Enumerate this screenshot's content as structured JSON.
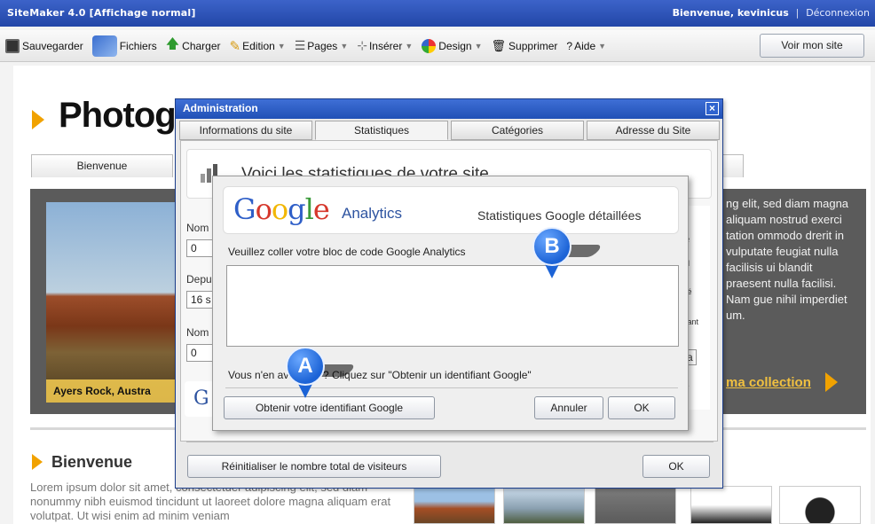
{
  "topbar": {
    "app_title": "SiteMaker 4.0",
    "mode": "[Affichage normal]",
    "welcome": "Bienvenue, kevinicus",
    "separator": "|",
    "logout": "Déconnexion"
  },
  "toolbar": {
    "save": "Sauvegarder",
    "files": "Fichiers",
    "upload": "Charger",
    "edit": "Edition",
    "pages": "Pages",
    "insert": "Insérer",
    "design": "Design",
    "delete": "Supprimer",
    "help": "Aide",
    "view_site": "Voir mon site"
  },
  "background_page": {
    "title": "Photogr",
    "tab": "Bienvenue",
    "photo_caption": "Ayers Rock, Austra",
    "band_text": "ng elit, sed diam magna aliquam nostrud exerci tation ommodo drerit in vulputate feugiat nulla facilisis ui blandit praesent nulla facilisi. Nam gue nihil imperdiet um.",
    "band_link": "ma collection",
    "section_title": "Bienvenue",
    "lorem": "Lorem ipsum dolor sit amet, consectetuer adipiscing elit, sed diam nonummy nibh euismod tincidunt ut laoreet dolore magna aliquam erat volutpat. Ut wisi enim ad minim veniam"
  },
  "admin": {
    "title": "Administration",
    "close": "×",
    "tabs": [
      "Informations du site",
      "Statistiques",
      "Catégories",
      "Adresse du Site"
    ],
    "active_tab": "Statistiques",
    "stats_title": "Voici les statistiques de votre site",
    "labels": [
      "Nom",
      "Depu",
      "Nom"
    ],
    "fields": [
      "0",
      "16 s",
      "0"
    ],
    "right_labels": [
      "e",
      "al",
      "sé",
      "itant",
      "a",
      "e"
    ],
    "reset_button": "Réinitialiser le nombre total de visiteurs",
    "ok_button": "OK"
  },
  "google_dialog": {
    "logo_letters": [
      "G",
      "o",
      "o",
      "g",
      "l",
      "e"
    ],
    "analytics": "Analytics",
    "subtitle": "Statistiques Google détaillées",
    "paste_label": "Veuillez coller votre bloc de code Google Analytics",
    "code_value": "",
    "hint": "Vous n'en avez pas ? Cliquez sur \"Obtenir un identifiant Google\"",
    "obtain_button": "Obtenir votre identifiant Google",
    "cancel_button": "Annuler",
    "ok_button": "OK"
  },
  "markers": {
    "a": "A",
    "b": "B"
  },
  "colors": {
    "accent_blue": "#2246a7",
    "gold": "#f1a200",
    "band_gray": "#5b5b5b"
  },
  "icons": [
    "floppy-icon",
    "files-icon",
    "upload-arrow-icon",
    "pencil-icon",
    "pages-icon",
    "insert-icon",
    "design-palette-icon",
    "trash-icon",
    "help-icon",
    "close-icon",
    "stats-chart-icon",
    "google-icon"
  ]
}
